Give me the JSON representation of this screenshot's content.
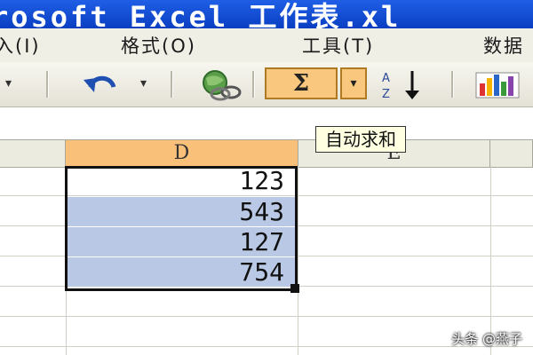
{
  "window": {
    "title": "rosoft Excel 工作表.xl"
  },
  "menu": {
    "items": [
      "入(I)",
      "格式(O)",
      "工具(T)",
      "数据"
    ]
  },
  "toolbar": {
    "sigma_label": "Σ",
    "sigma_dropdown": "▾",
    "undo_dropdown": "▾",
    "sort_label": "↓"
  },
  "tooltip": {
    "text": "自动求和"
  },
  "sheet": {
    "columns": [
      "D",
      "E"
    ],
    "active_column": "D",
    "selected_values": [
      "123",
      "543",
      "127",
      "754"
    ]
  },
  "watermark": "头条 @燕子",
  "colors": {
    "titlebar": "#0a3fc2",
    "active_button": "#f9c77e",
    "selection": "#b9c8e4",
    "tooltip_bg": "#ffffe1"
  }
}
